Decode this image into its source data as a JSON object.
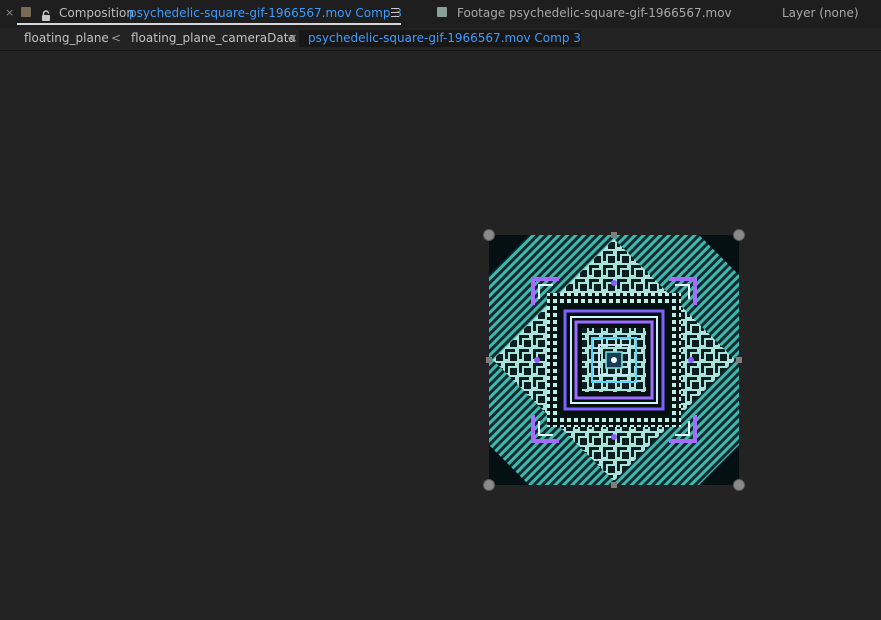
{
  "tabs": {
    "close_glyph": "×",
    "composition_label": "Composition",
    "composition_name": "psychedelic-square-gif-1966567.mov Comp 3",
    "footage_label": "Footage psychedelic-square-gif-1966567.mov",
    "layer_label": "Layer (none)"
  },
  "breadcrumb": {
    "items": [
      {
        "label": "floating_plane"
      },
      {
        "label": "floating_plane_cameraData"
      },
      {
        "label": "psychedelic-square-gif-1966567.mov Comp 3"
      }
    ],
    "separator": "<"
  },
  "viewer": {
    "layer_icon": "psychedelic-square-footage"
  },
  "colors": {
    "panel_bg": "#232323",
    "tab_bg": "#1e1e1e",
    "accent_blue": "#3d9bff",
    "composition_swatch": "#7a6a55",
    "footage_swatch": "#8aa19b"
  }
}
